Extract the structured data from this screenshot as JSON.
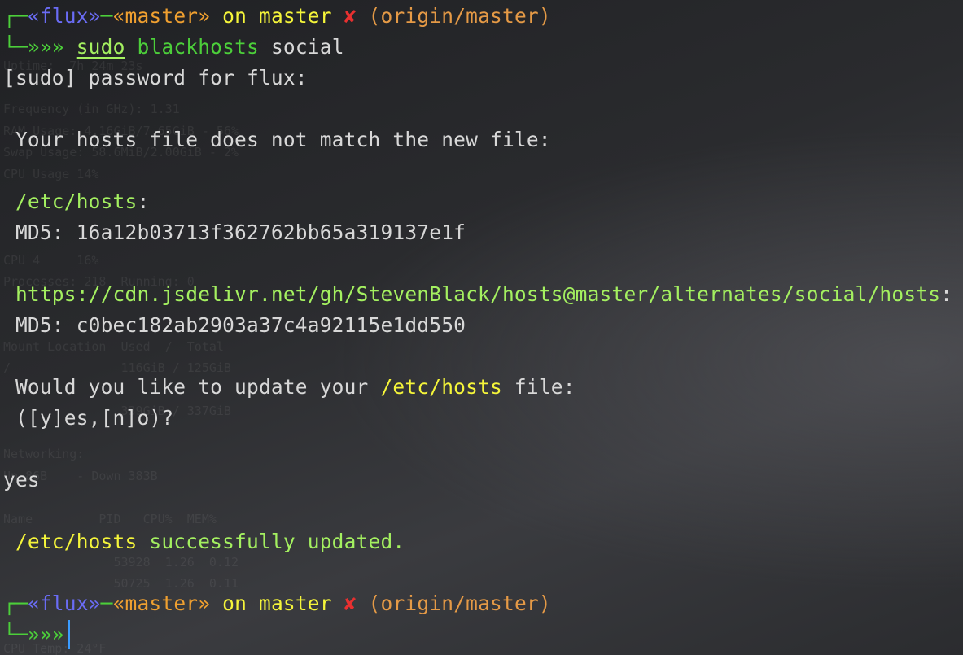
{
  "window": {
    "title": ""
  },
  "prompt1": {
    "corner_top": "┌─",
    "user_open": "«",
    "user": "flux",
    "user_close": "»",
    "dash": "─",
    "branch_open": "«",
    "branch": "master",
    "branch_close": "»",
    "on_master": " on master ",
    "dirty_mark": "✘",
    "origin": " (origin/master)",
    "corner_bottom": "└─",
    "arrows": "»»» ",
    "cmd_sudo": "sudo",
    "cmd_space": " ",
    "cmd_bin": "blackhosts",
    "cmd_arg": " social"
  },
  "output": {
    "sudo_prompt": "[sudo] password for flux:",
    "mismatch": " Your hosts file does not match the new file:",
    "local_path": " /etc/hosts",
    "local_colon": ":",
    "md5_label": " MD5: ",
    "local_md5": "16a12b03713f362762bb65a319137e1f",
    "remote_url": " https://cdn.jsdelivr.net/gh/StevenBlack/hosts@master/alternates/social/hosts",
    "remote_colon": ":",
    "remote_md5_label": " MD5: ",
    "remote_md5": "c0bec182ab2903a37c4a92115e1dd550",
    "question_pre": " Would you like to update your ",
    "question_path": "/etc/hosts",
    "question_post": " file:",
    "options": " ([y]es,[n]o)?",
    "answer": "yes",
    "success_path": " /etc/hosts",
    "success_msg": " successfully updated."
  },
  "prompt2": {
    "corner_top": "┌─",
    "user_open": "«",
    "user": "flux",
    "user_close": "»",
    "dash": "─",
    "branch_open": "«",
    "branch": "master",
    "branch_close": "»",
    "on_master": " on master ",
    "dirty_mark": "✘",
    "origin": " (origin/master)",
    "corner_bottom": "└─",
    "arrows": "»»»"
  },
  "background_panel": {
    "lines": [
      "Uptime:  7h 24m 23s",
      "",
      "Frequency (in GHz): 1.31",
      "RAM Usage: 4.16GiB/7.65GiB - 56%",
      "Swap Usage: 58.6MiB/2.00GiB - 2%",
      "CPU Usage 14%",
      "",
      "",
      "",
      "CPU 4     16%",
      "Processes: 218  Running: 0",
      "",
      "",
      "Mount Location  Used  /  Total",
      "/               116GiB / 125GiB",
      "",
      "                339GiB / 337GiB",
      "",
      "Networking:",
      "Up 86B    - Down 383B",
      "",
      "Name         PID   CPU%  MEM%",
      "",
      "               53928  1.26  0.12",
      "               50725  1.26  0.11",
      "",
      "",
      "CPU Temp: 24°F"
    ]
  }
}
